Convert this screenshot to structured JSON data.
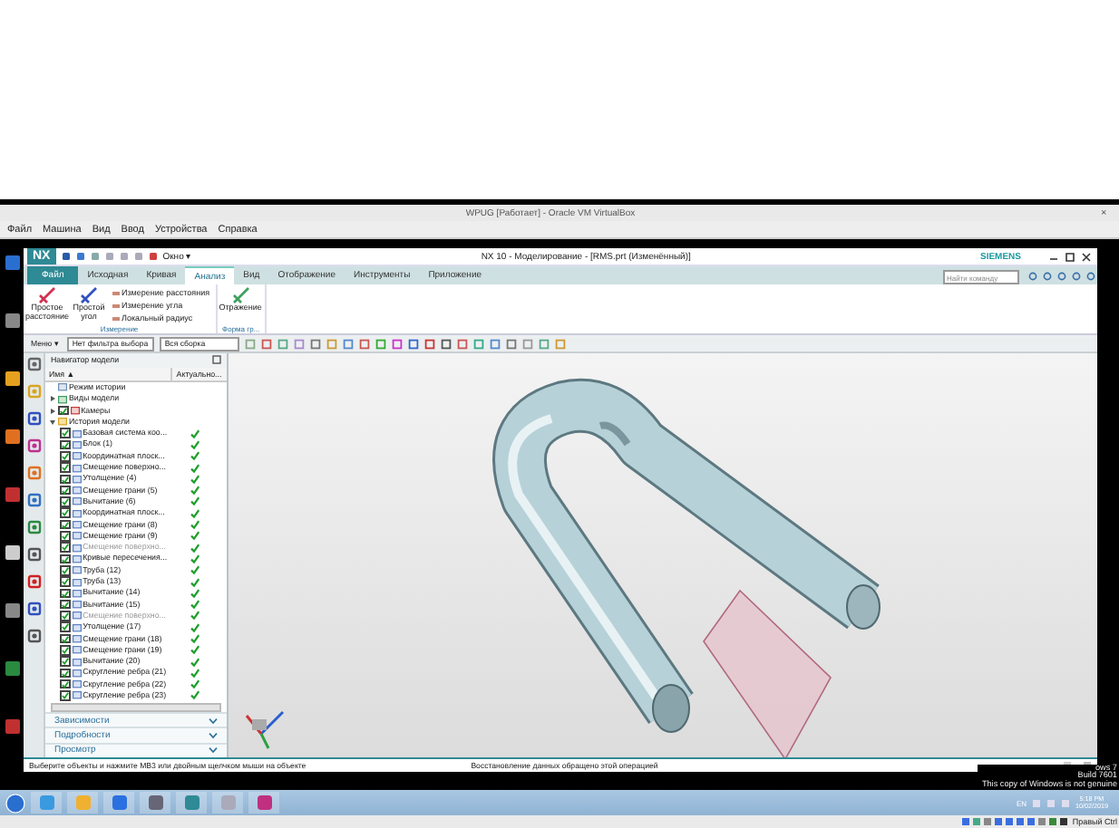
{
  "vbox": {
    "title": "WPUG [Работает] - Oracle VM VirtualBox",
    "close": "×",
    "menu": [
      "Файл",
      "Машина",
      "Вид",
      "Ввод",
      "Устройства",
      "Справка"
    ],
    "host_key": "Правый Ctrl"
  },
  "nx": {
    "logo": "NX",
    "window_menu": "Окно ▾",
    "title": "NX 10 - Моделирование - [RMS.prt (Изменённый)]",
    "brand": "SIEMENS",
    "tabs": [
      {
        "label": "Файл",
        "kind": "file",
        "selected": false
      },
      {
        "label": "Исходная",
        "kind": "tab",
        "selected": false
      },
      {
        "label": "Кривая",
        "kind": "tab",
        "selected": false
      },
      {
        "label": "Анализ",
        "kind": "tab",
        "selected": true
      },
      {
        "label": "Вид",
        "kind": "tab",
        "selected": false
      },
      {
        "label": "Отображение",
        "kind": "tab",
        "selected": false
      },
      {
        "label": "Инструменты",
        "kind": "tab",
        "selected": false
      },
      {
        "label": "Приложение",
        "kind": "tab",
        "selected": false
      }
    ],
    "search": {
      "placeholder": "Найти команду"
    },
    "ribbon_groups": [
      {
        "label": "Измерение",
        "large": [
          "Простое расстояние",
          "Простой угол"
        ],
        "small": [
          "Измерение расстояния",
          "Измерение угла",
          "Локальный радиус"
        ]
      },
      {
        "label": "Форма гр...",
        "large": [
          "Отражение"
        ]
      }
    ],
    "selection_bar": {
      "menu": "Меню ▾",
      "filter": "Нет фильтра выбора",
      "scope": "Вся сборка"
    },
    "navigator": {
      "title": "Навигатор модели",
      "columns": [
        "Имя ▲",
        "Актуально..."
      ],
      "items": [
        {
          "label": "Режим истории",
          "kind": "mode"
        },
        {
          "label": "Виды модели",
          "kind": "views",
          "expanded": false
        },
        {
          "label": "Камеры",
          "kind": "cameras",
          "expanded": false,
          "checked": true
        },
        {
          "label": "История модели",
          "kind": "history",
          "expanded": true,
          "children": [
            {
              "label": "Базовая система коо...",
              "checked": true,
              "up_to_date": true,
              "dimmed": false
            },
            {
              "label": "Блок (1)",
              "checked": true,
              "up_to_date": true,
              "dimmed": false
            },
            {
              "label": "Координатная плоск...",
              "checked": true,
              "up_to_date": true,
              "dimmed": false
            },
            {
              "label": "Смещение поверхно...",
              "checked": true,
              "up_to_date": true,
              "dimmed": false
            },
            {
              "label": "Утолщение (4)",
              "checked": true,
              "up_to_date": true,
              "dimmed": false
            },
            {
              "label": "Смещение грани (5)",
              "checked": true,
              "up_to_date": true,
              "dimmed": false
            },
            {
              "label": "Вычитание (6)",
              "checked": true,
              "up_to_date": true,
              "dimmed": false
            },
            {
              "label": "Координатная плоск...",
              "checked": true,
              "up_to_date": true,
              "dimmed": false
            },
            {
              "label": "Смещение грани (8)",
              "checked": true,
              "up_to_date": true,
              "dimmed": false
            },
            {
              "label": "Смещение грани (9)",
              "checked": true,
              "up_to_date": true,
              "dimmed": false
            },
            {
              "label": "Смещение поверхно...",
              "checked": true,
              "up_to_date": true,
              "dimmed": true
            },
            {
              "label": "Кривые пересечения...",
              "checked": true,
              "up_to_date": true,
              "dimmed": false
            },
            {
              "label": "Труба (12)",
              "checked": true,
              "up_to_date": true,
              "dimmed": false
            },
            {
              "label": "Труба (13)",
              "checked": true,
              "up_to_date": true,
              "dimmed": false
            },
            {
              "label": "Вычитание (14)",
              "checked": true,
              "up_to_date": true,
              "dimmed": false
            },
            {
              "label": "Вычитание (15)",
              "checked": true,
              "up_to_date": true,
              "dimmed": false
            },
            {
              "label": "Смещение поверхно...",
              "checked": true,
              "up_to_date": true,
              "dimmed": true
            },
            {
              "label": "Утолщение (17)",
              "checked": true,
              "up_to_date": true,
              "dimmed": false
            },
            {
              "label": "Смещение грани (18)",
              "checked": true,
              "up_to_date": true,
              "dimmed": false
            },
            {
              "label": "Смещение грани (19)",
              "checked": true,
              "up_to_date": true,
              "dimmed": false
            },
            {
              "label": "Вычитание (20)",
              "checked": true,
              "up_to_date": true,
              "dimmed": false
            },
            {
              "label": "Скругление ребра (21)",
              "checked": true,
              "up_to_date": true,
              "dimmed": false
            },
            {
              "label": "Скругление ребра (22)",
              "checked": true,
              "up_to_date": true,
              "dimmed": false
            },
            {
              "label": "Скругление ребра (23)",
              "checked": true,
              "up_to_date": true,
              "dimmed": false
            }
          ]
        }
      ]
    },
    "panels": [
      "Зависимости",
      "Подробности",
      "Просмотр"
    ],
    "status": {
      "prompt": "Выберите объекты и нажмите MB3 или двойным щелчком мыши на объекте",
      "message": "Восстановление данных обращено этой операцией"
    }
  },
  "desktop_notice": [
    "ows 7",
    "Build 7601",
    "This copy of Windows is not genuine"
  ],
  "taskbar": {
    "language": "EN",
    "time": "5:18 PM",
    "date": "10/02/2019"
  }
}
